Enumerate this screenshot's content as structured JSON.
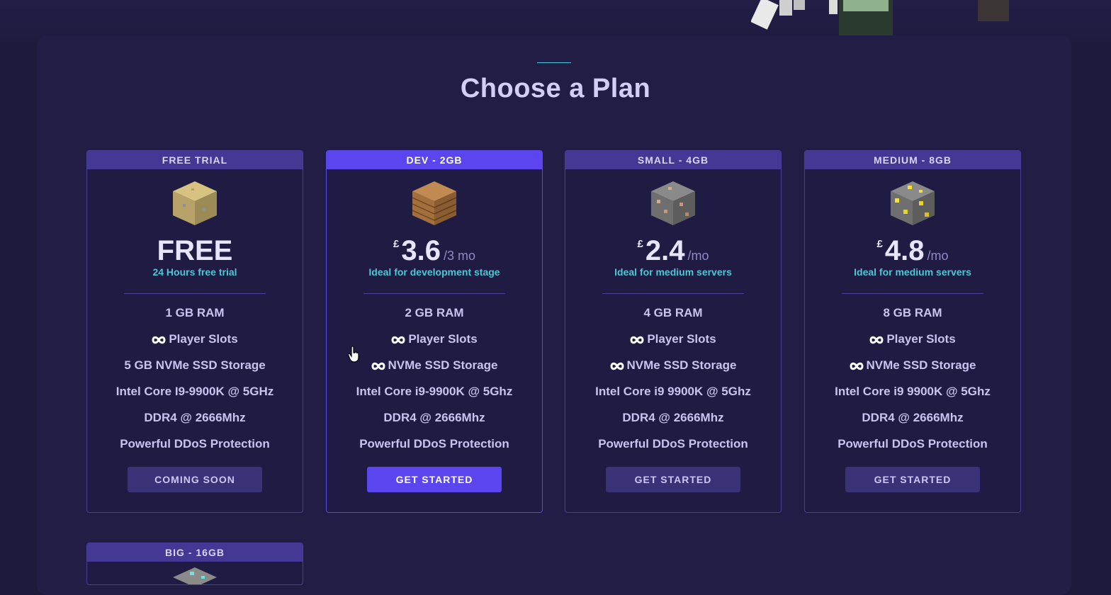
{
  "colors": {
    "background": "#1d1a3c",
    "panel": "#211d44",
    "accent": "#5b45ee",
    "card_head": "#433894",
    "subtitle_cyan": "#4cc8d4",
    "button": "#3a3277"
  },
  "section": {
    "title": "Choose a Plan"
  },
  "plans": [
    {
      "name": "FREE TRIAL",
      "icon": "sand-block-icon",
      "currency": "",
      "amount": "FREE",
      "period": "",
      "subtitle": "24 Hours free trial",
      "features": [
        {
          "text": "1 GB RAM",
          "infinity": false
        },
        {
          "text": "Player Slots",
          "infinity": true
        },
        {
          "text": "5 GB NVMe SSD Storage",
          "infinity": false
        },
        {
          "text": "Intel Core I9-9900K @ 5GHz",
          "infinity": false
        },
        {
          "text": "DDR4 @ 2666Mhz",
          "infinity": false
        },
        {
          "text": "Powerful DDoS Protection",
          "infinity": false
        }
      ],
      "button": "COMING SOON"
    },
    {
      "name": "DEV - 2GB",
      "icon": "wood-planks-icon",
      "currency": "£",
      "amount": "3.6",
      "period": "/3 mo",
      "subtitle": "Ideal for development stage",
      "features": [
        {
          "text": "2 GB RAM",
          "infinity": false
        },
        {
          "text": "Player Slots",
          "infinity": true
        },
        {
          "text": "NVMe SSD Storage",
          "infinity": true
        },
        {
          "text": "Intel Core i9-9900K @ 5Ghz",
          "infinity": false
        },
        {
          "text": "DDR4 @ 2666Mhz",
          "infinity": false
        },
        {
          "text": "Powerful DDoS Protection",
          "infinity": false
        }
      ],
      "button": "GET STARTED"
    },
    {
      "name": "SMALL - 4GB",
      "icon": "iron-ore-icon",
      "currency": "£",
      "amount": "2.4",
      "period": "/mo",
      "subtitle": "Ideal for medium servers",
      "features": [
        {
          "text": "4 GB RAM",
          "infinity": false
        },
        {
          "text": "Player Slots",
          "infinity": true
        },
        {
          "text": "NVMe SSD Storage",
          "infinity": true
        },
        {
          "text": "Intel Core i9 9900K @ 5Ghz",
          "infinity": false
        },
        {
          "text": "DDR4 @ 2666Mhz",
          "infinity": false
        },
        {
          "text": "Powerful DDoS Protection",
          "infinity": false
        }
      ],
      "button": "GET STARTED"
    },
    {
      "name": "MEDIUM - 8GB",
      "icon": "gold-ore-icon",
      "currency": "£",
      "amount": "4.8",
      "period": "/mo",
      "subtitle": "Ideal for medium servers",
      "features": [
        {
          "text": "8 GB RAM",
          "infinity": false
        },
        {
          "text": "Player Slots",
          "infinity": true
        },
        {
          "text": "NVMe SSD Storage",
          "infinity": true
        },
        {
          "text": "Intel Core i9 9900K @ 5Ghz",
          "infinity": false
        },
        {
          "text": "DDR4 @ 2666Mhz",
          "infinity": false
        },
        {
          "text": "Powerful DDoS Protection",
          "infinity": false
        }
      ],
      "button": "GET STARTED"
    },
    {
      "name": "BIG - 16GB",
      "icon": "diamond-ore-icon"
    }
  ]
}
